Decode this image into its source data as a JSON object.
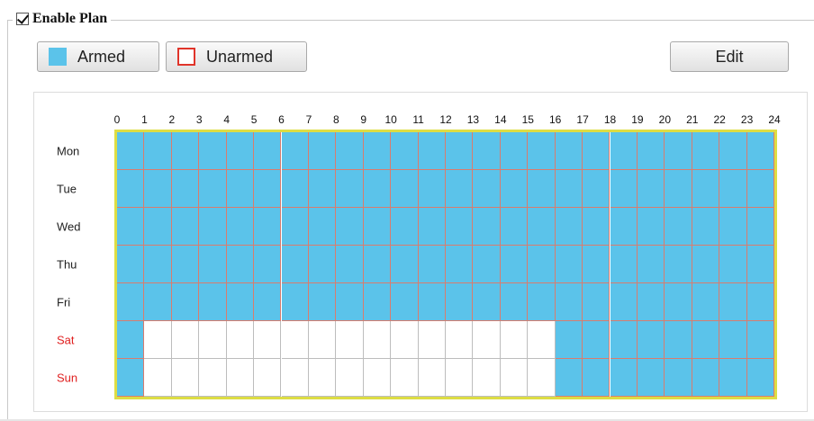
{
  "plan": {
    "enable_label": "Enable Plan",
    "enabled": true
  },
  "legend_buttons": {
    "armed_label": "Armed",
    "unarmed_label": "Unarmed"
  },
  "edit_label": "Edit",
  "colors": {
    "armed": "#5bc3ea",
    "unarmed_border": "#e0342a",
    "grid_line": "#d97c6e",
    "grid_border": "#dddd44",
    "weekend_text": "#e02020"
  },
  "schedule": {
    "hour_labels": [
      "0",
      "1",
      "2",
      "3",
      "4",
      "5",
      "6",
      "7",
      "8",
      "9",
      "10",
      "11",
      "12",
      "13",
      "14",
      "15",
      "16",
      "17",
      "18",
      "19",
      "20",
      "21",
      "22",
      "23",
      "24"
    ],
    "days": [
      {
        "label": "Mon",
        "weekend": false,
        "armed": [
          1,
          1,
          1,
          1,
          1,
          1,
          1,
          1,
          1,
          1,
          1,
          1,
          1,
          1,
          1,
          1,
          1,
          1,
          1,
          1,
          1,
          1,
          1,
          1
        ]
      },
      {
        "label": "Tue",
        "weekend": false,
        "armed": [
          1,
          1,
          1,
          1,
          1,
          1,
          1,
          1,
          1,
          1,
          1,
          1,
          1,
          1,
          1,
          1,
          1,
          1,
          1,
          1,
          1,
          1,
          1,
          1
        ]
      },
      {
        "label": "Wed",
        "weekend": false,
        "armed": [
          1,
          1,
          1,
          1,
          1,
          1,
          1,
          1,
          1,
          1,
          1,
          1,
          1,
          1,
          1,
          1,
          1,
          1,
          1,
          1,
          1,
          1,
          1,
          1
        ]
      },
      {
        "label": "Thu",
        "weekend": false,
        "armed": [
          1,
          1,
          1,
          1,
          1,
          1,
          1,
          1,
          1,
          1,
          1,
          1,
          1,
          1,
          1,
          1,
          1,
          1,
          1,
          1,
          1,
          1,
          1,
          1
        ]
      },
      {
        "label": "Fri",
        "weekend": false,
        "armed": [
          1,
          1,
          1,
          1,
          1,
          1,
          1,
          1,
          1,
          1,
          1,
          1,
          1,
          1,
          1,
          1,
          1,
          1,
          1,
          1,
          1,
          1,
          1,
          1
        ]
      },
      {
        "label": "Sat",
        "weekend": true,
        "armed": [
          1,
          0,
          0,
          0,
          0,
          0,
          0,
          0,
          0,
          0,
          0,
          0,
          0,
          0,
          0,
          0,
          1,
          1,
          1,
          1,
          1,
          1,
          1,
          1
        ]
      },
      {
        "label": "Sun",
        "weekend": true,
        "armed": [
          1,
          0,
          0,
          0,
          0,
          0,
          0,
          0,
          0,
          0,
          0,
          0,
          0,
          0,
          0,
          0,
          1,
          1,
          1,
          1,
          1,
          1,
          1,
          1
        ]
      }
    ]
  }
}
